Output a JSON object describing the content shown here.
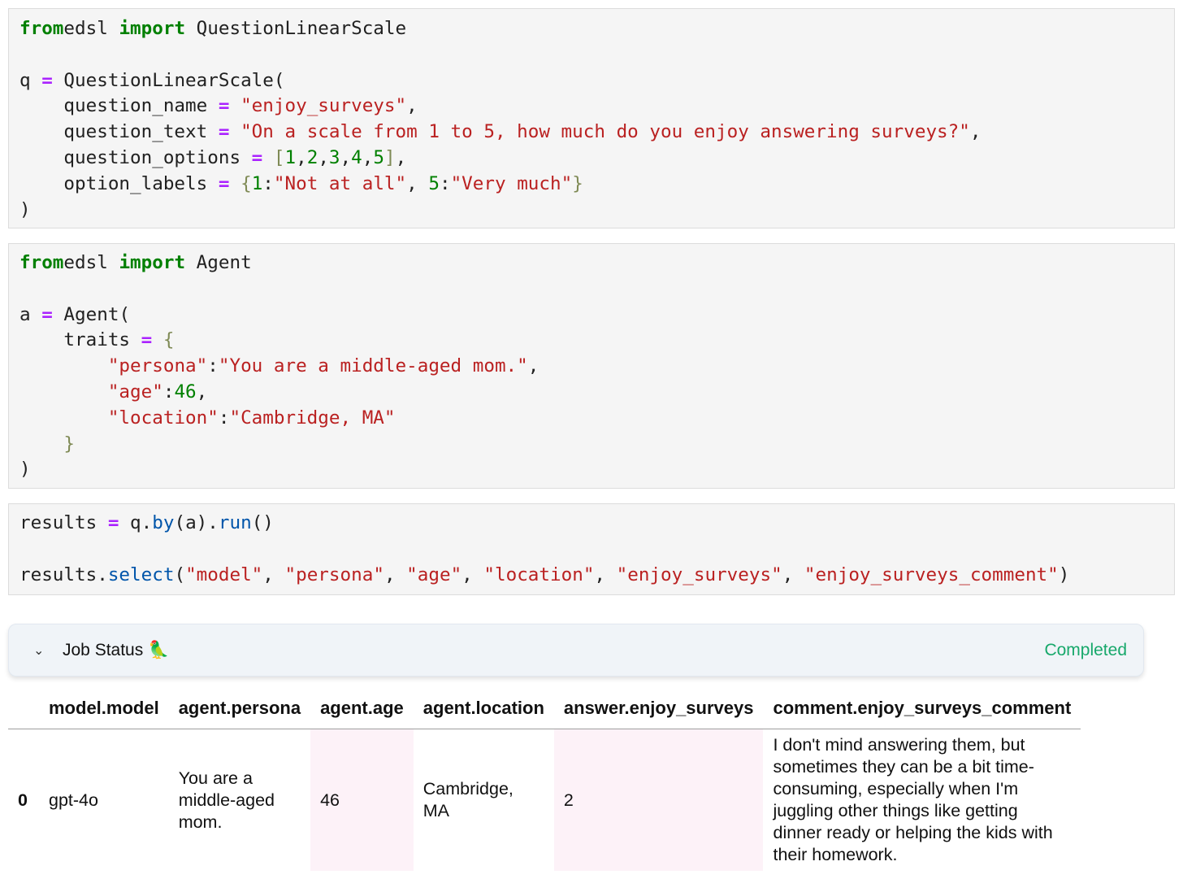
{
  "cells": [
    {
      "lines": [
        [
          [
            "kw",
            "from"
          ],
          [
            "",
            "edsl "
          ],
          [
            "kw",
            "import"
          ],
          [
            "",
            " QuestionLinearScale"
          ]
        ],
        [],
        [
          [
            "",
            "q "
          ],
          [
            "op",
            "="
          ],
          [
            "",
            " QuestionLinearScale("
          ]
        ],
        [
          [
            "",
            "    question_name "
          ],
          [
            "op",
            "="
          ],
          [
            "",
            " "
          ],
          [
            "st",
            "\"enjoy_surveys\""
          ],
          [
            "",
            ","
          ]
        ],
        [
          [
            "",
            "    question_text "
          ],
          [
            "op",
            "="
          ],
          [
            "",
            " "
          ],
          [
            "st",
            "\"On a scale from 1 to 5, how much do you enjoy answering surveys?\""
          ],
          [
            "",
            ","
          ]
        ],
        [
          [
            "",
            "    question_options "
          ],
          [
            "op",
            "="
          ],
          [
            "",
            " "
          ],
          [
            "br",
            "["
          ],
          [
            "nm",
            "1"
          ],
          [
            "",
            ","
          ],
          [
            "nm",
            "2"
          ],
          [
            "",
            ","
          ],
          [
            "nm",
            "3"
          ],
          [
            "",
            ","
          ],
          [
            "nm",
            "4"
          ],
          [
            "",
            ","
          ],
          [
            "nm",
            "5"
          ],
          [
            "br",
            "]"
          ],
          [
            "",
            ","
          ]
        ],
        [
          [
            "",
            "    option_labels "
          ],
          [
            "op",
            "="
          ],
          [
            "",
            " "
          ],
          [
            "br",
            "{"
          ],
          [
            "nm",
            "1"
          ],
          [
            "",
            ":"
          ],
          [
            "st",
            "\"Not at all\""
          ],
          [
            "",
            ", "
          ],
          [
            "nm",
            "5"
          ],
          [
            "",
            ":"
          ],
          [
            "st",
            "\"Very much\""
          ],
          [
            "br",
            "}"
          ]
        ],
        [
          [
            "",
            ")"
          ]
        ]
      ]
    },
    {
      "lines": [
        [
          [
            "kw",
            "from"
          ],
          [
            "",
            "edsl "
          ],
          [
            "kw",
            "import"
          ],
          [
            "",
            " Agent"
          ]
        ],
        [],
        [
          [
            "",
            "a "
          ],
          [
            "op",
            "="
          ],
          [
            "",
            " Agent("
          ]
        ],
        [
          [
            "",
            "    traits "
          ],
          [
            "op",
            "="
          ],
          [
            "",
            " "
          ],
          [
            "br",
            "{"
          ]
        ],
        [
          [
            "",
            "        "
          ],
          [
            "st",
            "\"persona\""
          ],
          [
            "",
            ":"
          ],
          [
            "st",
            "\"You are a middle-aged mom.\""
          ],
          [
            "",
            ","
          ]
        ],
        [
          [
            "",
            "        "
          ],
          [
            "st",
            "\"age\""
          ],
          [
            "",
            ":"
          ],
          [
            "nm",
            "46"
          ],
          [
            "",
            ","
          ]
        ],
        [
          [
            "",
            "        "
          ],
          [
            "st",
            "\"location\""
          ],
          [
            "",
            ":"
          ],
          [
            "st",
            "\"Cambridge, MA\""
          ]
        ],
        [
          [
            "",
            "    "
          ],
          [
            "br",
            "}"
          ]
        ],
        [
          [
            "",
            ")"
          ]
        ]
      ]
    },
    {
      "lines": [
        [
          [
            "",
            "results "
          ],
          [
            "op",
            "="
          ],
          [
            "",
            " q."
          ],
          [
            "fn",
            "by"
          ],
          [
            "",
            "(a)."
          ],
          [
            "fn",
            "run"
          ],
          [
            "",
            "()"
          ]
        ],
        [],
        [
          [
            "",
            "results."
          ],
          [
            "fn",
            "select"
          ],
          [
            "",
            "("
          ],
          [
            "st",
            "\"model\""
          ],
          [
            "",
            ", "
          ],
          [
            "st",
            "\"persona\""
          ],
          [
            "",
            ", "
          ],
          [
            "st",
            "\"age\""
          ],
          [
            "",
            ", "
          ],
          [
            "st",
            "\"location\""
          ],
          [
            "",
            ", "
          ],
          [
            "st",
            "\"enjoy_surveys\""
          ],
          [
            "",
            ", "
          ],
          [
            "st",
            "\"enjoy_surveys_comment\""
          ],
          [
            "",
            ")"
          ]
        ]
      ]
    }
  ],
  "job_status": {
    "title": "Job Status 🦜",
    "status": "Completed",
    "chevron": "⌄"
  },
  "table": {
    "headers": [
      "",
      "model.model",
      "agent.persona",
      "agent.age",
      "agent.location",
      "answer.enjoy_surveys",
      "comment.enjoy_surveys_comment"
    ],
    "rows": [
      [
        "0",
        "gpt-4o",
        "You are a middle-aged mom.",
        "46",
        "Cambridge, MA",
        "2",
        "I don't mind answering them, but sometimes they can be a bit time-consuming, especially when I'm juggling other things like getting dinner ready or helping the kids with their homework."
      ]
    ]
  }
}
